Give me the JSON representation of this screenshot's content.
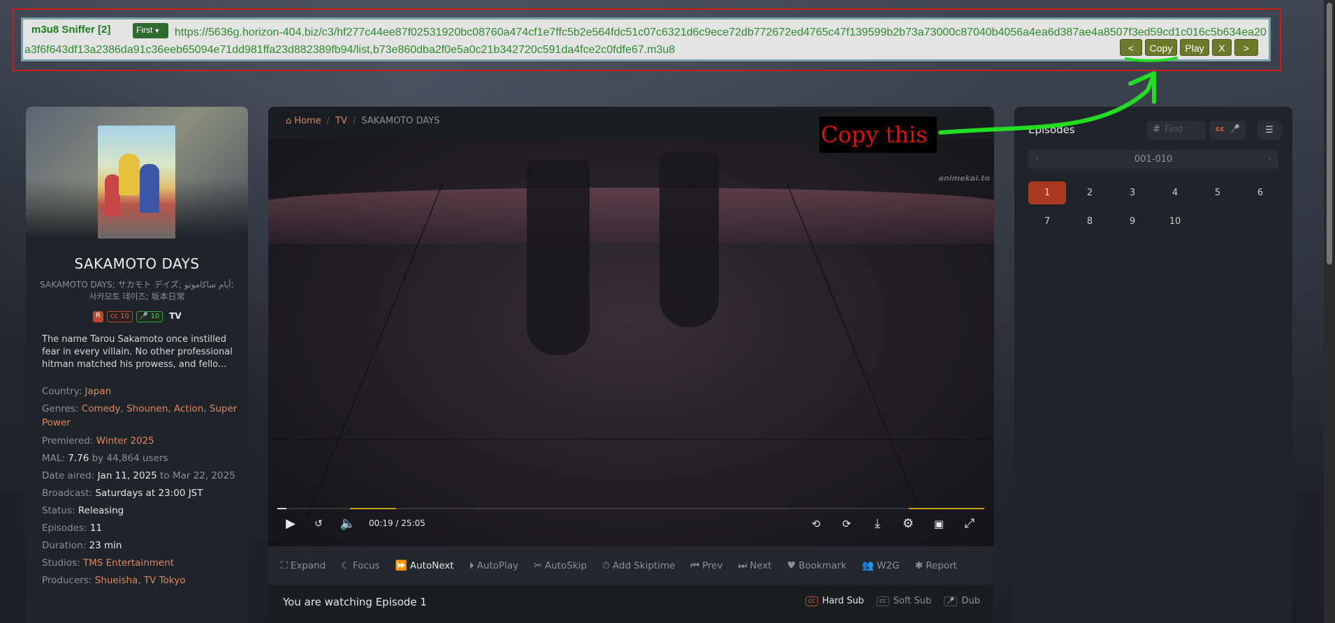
{
  "sniffer": {
    "title": "m3u8 Sniffer [2]",
    "select_value": "First",
    "url": "https://5636g.horizon-404.biz/c3/hf277c44ee87f02531920bc08760a474cf1e7ffc5b2e564fdc51c07c6321d6c9ece72db772672ed4765c47f139599b2b73a73000c87040b4056a4ea6d387ae4a8507f3ed59cd1c016c5b634ea20a3f6f643df13a2386da91c36eeb65094e71dd981ffa23d882389fb94/list,b73e860dba2f0e5a0c21b342720c591da4fce2c0fdfe67.m3u8",
    "buttons": {
      "prev": "<",
      "copy": "Copy",
      "play": "Play",
      "close": "X",
      "next": ">"
    }
  },
  "annotation": {
    "label": "Copy this"
  },
  "anime": {
    "title": "SAKAMOTO DAYS",
    "alt_names": "SAKAMOTO DAYS; サカモト デイズ; أيام ساكاموتو; 사카모토 데이즈; 坂本日常",
    "rating": "R",
    "sub_count": "10",
    "dub_count": "10",
    "type": "TV",
    "description": "The name Tarou Sakamoto once instilled fear in every villain. No other professional hitman matched his prowess, and fello...",
    "meta": {
      "country_label": "Country:",
      "country": "Japan",
      "genres_label": "Genres:",
      "genres": [
        "Comedy",
        "Shounen",
        "Action",
        "Super Power"
      ],
      "premiered_label": "Premiered:",
      "premiered": "Winter 2025",
      "mal_label": "MAL:",
      "mal_score": "7.76",
      "mal_by": "by",
      "mal_users": "44,864 users",
      "date_label": "Date aired:",
      "date_start": "Jan 11, 2025",
      "date_to": "to",
      "date_end": "Mar 22, 2025",
      "broadcast_label": "Broadcast:",
      "broadcast": "Saturdays at 23:00 JST",
      "status_label": "Status:",
      "status": "Releasing",
      "episodes_label": "Episodes:",
      "episodes": "11",
      "duration_label": "Duration:",
      "duration": "23 min",
      "studios_label": "Studios:",
      "studios": "TMS Entertainment",
      "producers_label": "Producers:",
      "producers": [
        "Shueisha",
        "TV Tokyo"
      ]
    }
  },
  "breadcrumb": {
    "home": "Home",
    "tv": "TV",
    "current": "SAKAMOTO DAYS"
  },
  "player": {
    "watermark": "animekai.to",
    "current_time": "00:19",
    "separator": "/",
    "duration": "25:05",
    "progress_fraction": 0.0126
  },
  "toolbar": [
    {
      "label": "Expand",
      "icon": "expand-icon"
    },
    {
      "label": "Focus",
      "icon": "moon-icon"
    },
    {
      "label": "AutoNext",
      "icon": "fast-forward-icon",
      "active": true
    },
    {
      "label": "AutoPlay",
      "icon": "play-circle-icon"
    },
    {
      "label": "AutoSkip",
      "icon": "scissors-icon"
    },
    {
      "label": "Add Skiptime",
      "icon": "stopwatch-icon"
    },
    {
      "label": "Prev",
      "icon": "skip-back-icon"
    },
    {
      "label": "Next",
      "icon": "skip-forward-icon"
    },
    {
      "label": "Bookmark",
      "icon": "heart-icon"
    },
    {
      "label": "W2G",
      "icon": "users-icon"
    },
    {
      "label": "Report",
      "icon": "bug-icon"
    }
  ],
  "watching": {
    "text": "You are watching Episode 1",
    "options": {
      "hard_sub": "Hard Sub",
      "soft_sub": "Soft Sub",
      "dub": "Dub"
    }
  },
  "episodes_panel": {
    "title": "Episodes",
    "find_placeholder": "Find",
    "range": "001-010",
    "items": [
      "1",
      "2",
      "3",
      "4",
      "5",
      "6",
      "7",
      "8",
      "9",
      "10"
    ],
    "current": "1"
  },
  "colors": {
    "accent": "#e0875e",
    "sniffer_green": "#2e8b2e",
    "arrow_green": "#22dd22",
    "frame_red": "#d11a1a"
  }
}
